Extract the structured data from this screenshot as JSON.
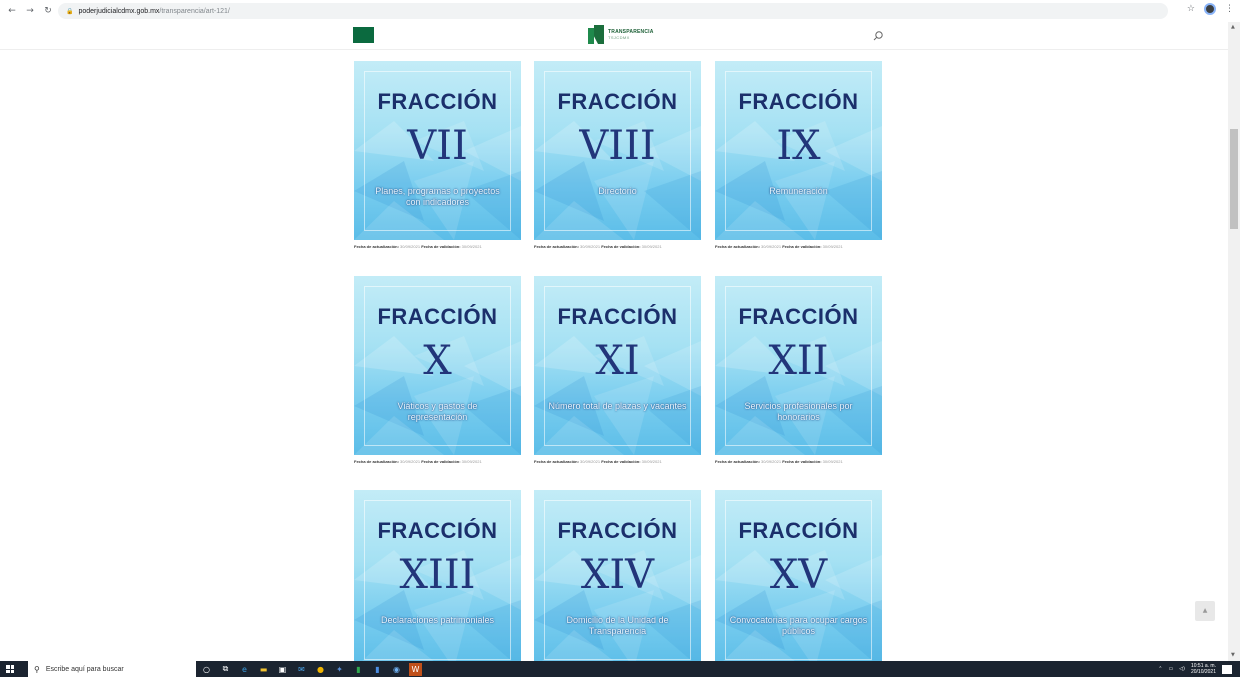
{
  "browser": {
    "url_host": "poderjudicialcdmx.gob.mx",
    "url_path": "/transparencia/art-121/"
  },
  "site": {
    "logo_line1": "TRANSPARENCIA",
    "logo_line2": "TSJCDMX"
  },
  "cards": [
    {
      "label": "FRACCIÓN",
      "numeral": "VII",
      "description": "Planes, programas o proyectos con indicadores",
      "updated_label": "Fecha de actualización:",
      "updated": "30/09/2021",
      "validated_label": "Fecha de validación:",
      "validated": "30/09/2021"
    },
    {
      "label": "FRACCIÓN",
      "numeral": "VIII",
      "description": "Directorio",
      "updated_label": "Fecha de actualización:",
      "updated": "30/09/2021",
      "validated_label": "Fecha de validación:",
      "validated": "30/09/2021"
    },
    {
      "label": "FRACCIÓN",
      "numeral": "IX",
      "description": "Remuneración",
      "updated_label": "Fecha de actualización:",
      "updated": "30/09/2021",
      "validated_label": "Fecha de validación:",
      "validated": "30/09/2021"
    },
    {
      "label": "FRACCIÓN",
      "numeral": "X",
      "description": "Viáticos y gastos de representación",
      "updated_label": "Fecha de actualización:",
      "updated": "30/09/2021",
      "validated_label": "Fecha de validación:",
      "validated": "30/09/2021"
    },
    {
      "label": "FRACCIÓN",
      "numeral": "XI",
      "description": "Número total de plazas y vacantes",
      "updated_label": "Fecha de actualización:",
      "updated": "30/09/2021",
      "validated_label": "Fecha de validación:",
      "validated": "30/09/2021"
    },
    {
      "label": "FRACCIÓN",
      "numeral": "XII",
      "description": "Servicios profesionales por honorarios",
      "updated_label": "Fecha de actualización:",
      "updated": "30/09/2021",
      "validated_label": "Fecha de validación:",
      "validated": "30/09/2021"
    },
    {
      "label": "FRACCIÓN",
      "numeral": "XIII",
      "description": "Declaraciones patrimoniales",
      "updated_label": "",
      "updated": "",
      "validated_label": "",
      "validated": ""
    },
    {
      "label": "FRACCIÓN",
      "numeral": "XIV",
      "description": "Domicilio de la Unidad de Transparencia",
      "updated_label": "",
      "updated": "",
      "validated_label": "",
      "validated": ""
    },
    {
      "label": "FRACCIÓN",
      "numeral": "XV",
      "description": "Convocatorias para ocupar cargos públicos",
      "updated_label": "",
      "updated": "",
      "validated_label": "",
      "validated": ""
    }
  ],
  "taskbar": {
    "search_placeholder": "Escribe aquí para buscar",
    "time": "10:51 a. m.",
    "date": "20/10/2021"
  },
  "colors": {
    "brand_green": "#0b6a3f",
    "numeral_blue": "#22357a",
    "taskbar": "#1b2430"
  }
}
